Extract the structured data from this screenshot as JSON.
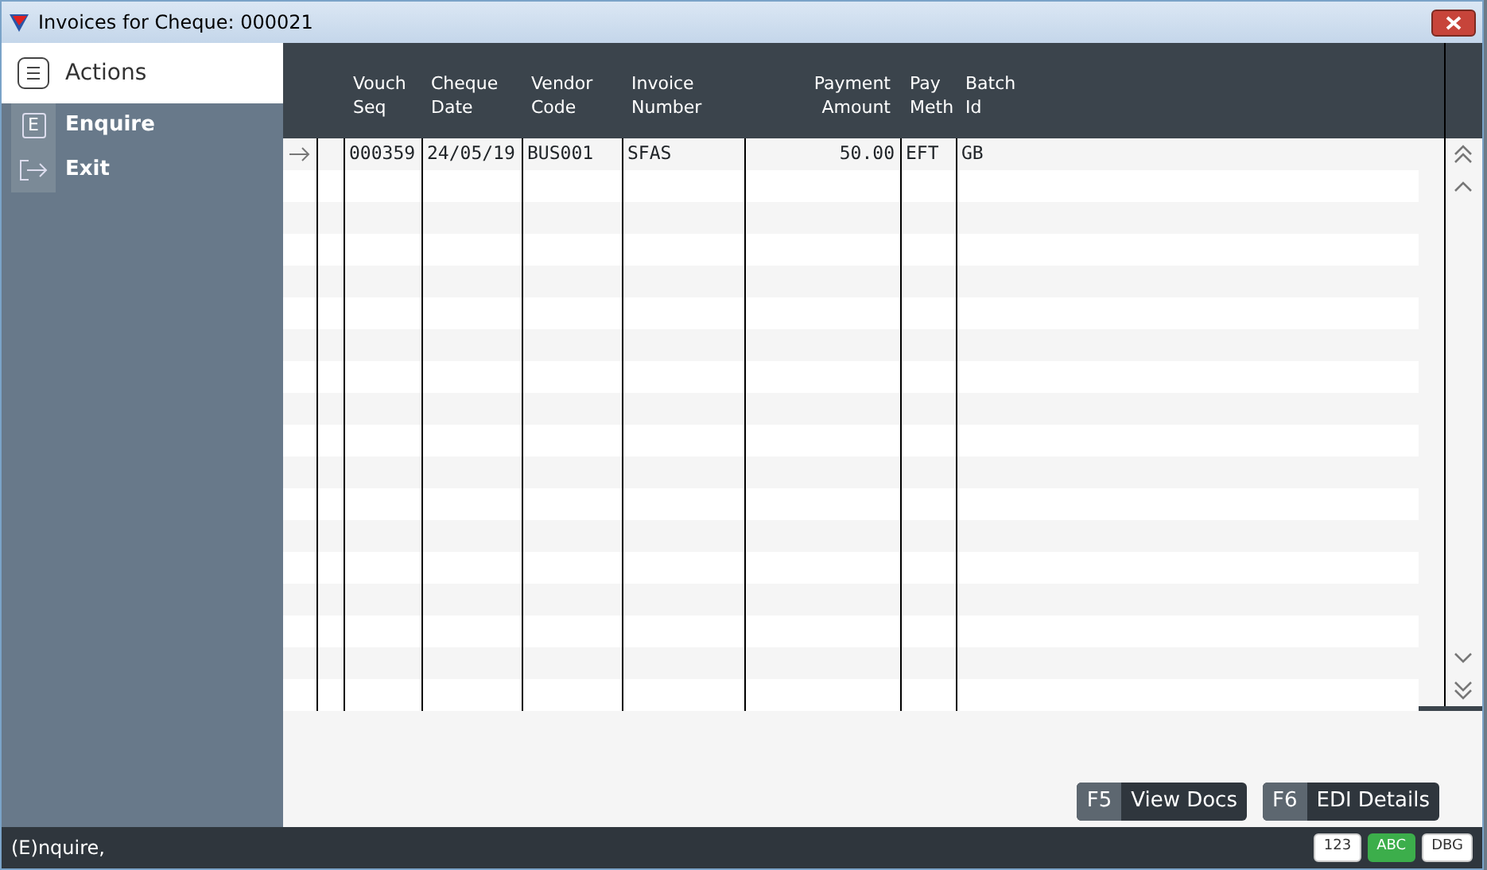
{
  "window": {
    "title": "Invoices for Cheque: 000021"
  },
  "sidebar": {
    "title": "Actions",
    "items": [
      {
        "kind": "key",
        "key": "E",
        "label": "Enquire"
      },
      {
        "kind": "exit",
        "label": "Exit"
      }
    ]
  },
  "table": {
    "columns": [
      "Vouch\nSeq",
      "Cheque\nDate",
      "Vendor\nCode",
      "Invoice\nNumber",
      "Payment\nAmount",
      "Pay\nMeth",
      "Batch\nId"
    ],
    "rows": [
      {
        "current": true,
        "cells": [
          "000359",
          "24/05/19",
          "BUS001",
          "SFAS",
          "50.00",
          "EFT",
          "GB"
        ]
      }
    ]
  },
  "buttons": [
    {
      "key": "F5",
      "label": "View Docs"
    },
    {
      "key": "F6",
      "label": "EDI Details"
    }
  ],
  "status_bar": {
    "text": "(E)nquire,",
    "indicators": [
      {
        "label": "123",
        "on": false
      },
      {
        "label": "ABC",
        "on": true
      },
      {
        "label": "DBG",
        "on": false
      }
    ]
  }
}
